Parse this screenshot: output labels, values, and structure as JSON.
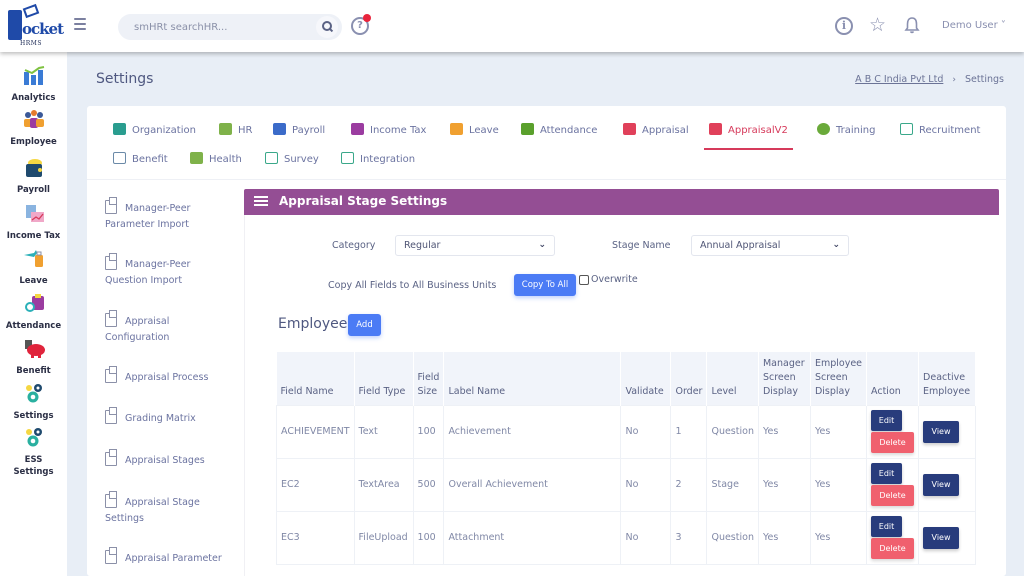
{
  "app": {
    "logo_text": "ocket",
    "logo_sub": "HRMS"
  },
  "topbar": {
    "search_placeholder": "smHRt searchHR...",
    "help_symbol": "?",
    "info_symbol": "i",
    "star_symbol": "☆",
    "user_label": "Demo User ˅"
  },
  "rail": {
    "items": [
      {
        "label": "Analytics",
        "icon": "analytics-icon"
      },
      {
        "label": "Employee",
        "icon": "employee-icon"
      },
      {
        "label": "Payroll",
        "icon": "payroll-icon"
      },
      {
        "label": "Income Tax",
        "icon": "income-tax-icon"
      },
      {
        "label": "Leave",
        "icon": "leave-icon"
      },
      {
        "label": "Attendance",
        "icon": "attendance-icon"
      },
      {
        "label": "Benefit",
        "icon": "benefit-icon"
      },
      {
        "label": "Settings",
        "icon": "settings-icon"
      },
      {
        "label": "ESS",
        "label2": "Settings",
        "icon": "ess-settings-icon"
      }
    ]
  },
  "page": {
    "title": "Settings",
    "breadcrumb": {
      "company": "A B C India Pvt Ltd",
      "separator": "›",
      "current": "Settings"
    }
  },
  "tabs": [
    {
      "label": "Organization",
      "icon": "organization-icon",
      "color": "#2a9d8f"
    },
    {
      "label": "HR",
      "icon": "hr-icon",
      "color": "#7fb24a"
    },
    {
      "label": "Payroll",
      "icon": "payroll-tab-icon",
      "color": "#3b6bc9"
    },
    {
      "label": "Income Tax",
      "icon": "income-tax-tab-icon",
      "color": "#9b3ca0"
    },
    {
      "label": "Leave",
      "icon": "leave-tab-icon",
      "color": "#f0a030"
    },
    {
      "label": "Attendance",
      "icon": "attendance-tab-icon",
      "color": "#5aa02c"
    },
    {
      "label": "Appraisal",
      "icon": "appraisal-icon",
      "color": "#e0405a"
    },
    {
      "label": "AppraisalV2",
      "icon": "appraisal-v2-icon",
      "color": "#e0405a",
      "active": true
    },
    {
      "label": "Training",
      "icon": "training-icon",
      "color": "#6aaa3a"
    },
    {
      "label": "Recruitment",
      "icon": "recruitment-icon",
      "color": "#3aa88a"
    },
    {
      "label": "Benefit",
      "icon": "benefit-tab-icon",
      "color": "#6b8aa8"
    },
    {
      "label": "Health",
      "icon": "health-icon",
      "color": "#7fb24a"
    },
    {
      "label": "Survey",
      "icon": "survey-icon",
      "color": "#3aa88a"
    },
    {
      "label": "Integration",
      "icon": "integration-icon",
      "color": "#3aa88a"
    }
  ],
  "side_menu": [
    {
      "line1": "Manager-Peer",
      "line2": "Parameter Import"
    },
    {
      "line1": "Manager-Peer",
      "line2": "Question Import"
    },
    {
      "line1": "Appraisal",
      "line2": "Configuration"
    },
    {
      "line1": "Appraisal Process",
      "line2": ""
    },
    {
      "line1": "Grading Matrix",
      "line2": ""
    },
    {
      "line1": "Appraisal Stages",
      "line2": ""
    },
    {
      "line1": "Appraisal Stage",
      "line2": "Settings"
    },
    {
      "line1": "Appraisal Parameter",
      "line2": ""
    }
  ],
  "panel": {
    "title": "Appraisal Stage Settings",
    "category_label": "Category",
    "category_value": "Regular",
    "stage_label": "Stage Name",
    "stage_value": "Annual Appraisal",
    "copy_label": "Copy All Fields to All Business Units",
    "copy_button": "Copy To All",
    "overwrite_label": "Overwrite",
    "section_title": "Employee",
    "add_button": "Add"
  },
  "table": {
    "headers": [
      [
        "Field Name"
      ],
      [
        "Field Type"
      ],
      [
        "Field",
        "Size"
      ],
      [
        "Label Name"
      ],
      [
        "Validate"
      ],
      [
        "Order"
      ],
      [
        "Level"
      ],
      [
        "Manager",
        "Screen",
        "Display"
      ],
      [
        "Employee",
        "Screen",
        "Display"
      ],
      [
        "Action"
      ],
      [
        "Deactive",
        "Employee"
      ]
    ],
    "rows": [
      {
        "field_name": "ACHIEVEMENT",
        "field_type": "Text",
        "field_size": "100",
        "label_name": "Achievement",
        "validate": "No",
        "order": "1",
        "level": "Question",
        "manager_display": "Yes",
        "employee_display": "Yes"
      },
      {
        "field_name": "EC2",
        "field_type": "TextArea",
        "field_size": "500",
        "label_name": "Overall Achievement",
        "validate": "No",
        "order": "2",
        "level": "Stage",
        "manager_display": "Yes",
        "employee_display": "Yes"
      },
      {
        "field_name": "EC3",
        "field_type": "FileUpload",
        "field_size": "100",
        "label_name": "Attachment",
        "validate": "No",
        "order": "3",
        "level": "Question",
        "manager_display": "Yes",
        "employee_display": "Yes"
      }
    ],
    "edit_label": "Edit",
    "delete_label": "Delete",
    "view_label": "View"
  },
  "colors": {
    "panel_header": "#944e94",
    "primary_button": "#4b7bf5",
    "dark_button": "#283c7c",
    "delete_button": "#f0606e",
    "active_tab": "#d63a5b"
  }
}
